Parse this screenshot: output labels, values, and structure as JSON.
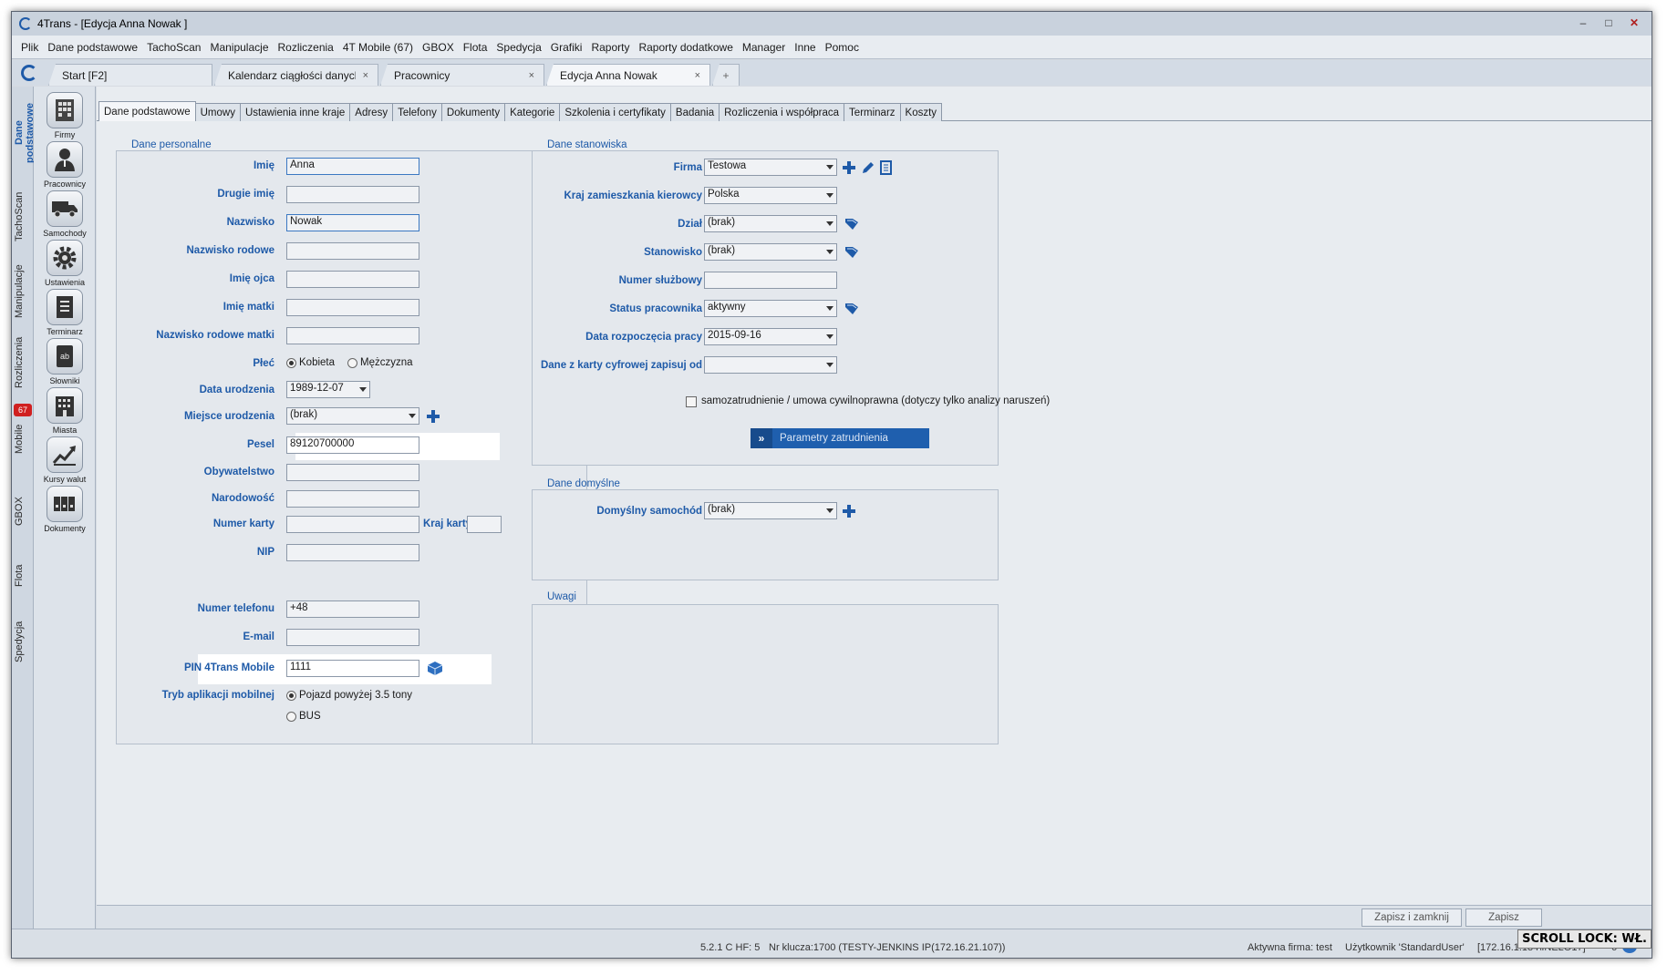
{
  "window": {
    "title": "4Trans - [Edycja   Anna Nowak   ]",
    "minimize": "–",
    "maximize": "□",
    "close": "✕"
  },
  "menu": [
    "Plik",
    "Dane podstawowe",
    "TachoScan",
    "Manipulacje",
    "Rozliczenia",
    "4T Mobile (67)",
    "GBOX",
    "Flota",
    "Spedycja",
    "Grafiki",
    "Raporty",
    "Raporty dodatkowe",
    "Manager",
    "Inne",
    "Pomoc"
  ],
  "doctabs": [
    {
      "label": "Start [F2]",
      "close": ""
    },
    {
      "label": "Kalendarz ciągłości danych",
      "close": "×"
    },
    {
      "label": "Pracownicy",
      "close": "×"
    },
    {
      "label": "Edycja Anna Nowak",
      "close": "×"
    }
  ],
  "doctab_add": "+",
  "vtabs": [
    "Dane podstawowe",
    "TachoScan",
    "Manipulacje",
    "Rozliczenia",
    "Mobile",
    "GBOX",
    "Flota",
    "Spedycja"
  ],
  "mobile_badge": "67",
  "navicons": [
    "Firmy",
    "Pracownicy",
    "Samochody",
    "Ustawienia",
    "Terminarz",
    "Słowniki",
    "Miasta",
    "Kursy walut",
    "Dokumenty"
  ],
  "subtabs": [
    "Dane podstawowe",
    "Umowy",
    "Ustawienia inne kraje",
    "Adresy",
    "Telefony",
    "Dokumenty",
    "Kategorie",
    "Szkolenia i certyfikaty",
    "Badania",
    "Rozliczenia i współpraca",
    "Terminarz",
    "Koszty"
  ],
  "personal": {
    "section_title": "Dane personalne",
    "imie_label": "Imię",
    "imie": "Anna",
    "drugie_label": "Drugie imię",
    "drugie": "",
    "nazwisko_label": "Nazwisko",
    "nazwisko": "Nowak",
    "rodowe_label": "Nazwisko rodowe",
    "rodowe": "",
    "ojca_label": "Imię ojca",
    "ojca": "",
    "matki_label": "Imię matki",
    "matki": "",
    "rodowe_matki_label": "Nazwisko rodowe matki",
    "rodowe_matki": "",
    "plec_label": "Płeć",
    "kobieta": "Kobieta",
    "mezczyzna": "Mężczyzna",
    "data_ur_label": "Data urodzenia",
    "data_ur": "1989-12-07",
    "miejsce_label": "Miejsce urodzenia",
    "miejsce": "(brak)",
    "pesel_label": "Pesel",
    "pesel": "89120700000",
    "obyw_label": "Obywatelstwo",
    "obyw": "",
    "narod_label": "Narodowość",
    "narod": "",
    "karta_label": "Numer karty",
    "karta": "",
    "kraj_karty_label": "Kraj karty",
    "kraj_karty": "",
    "nip_label": "NIP",
    "nip": "",
    "tel_label": "Numer telefonu",
    "tel": "+48",
    "email_label": "E-mail",
    "email": "",
    "pin_label": "PIN 4Trans Mobile",
    "pin": "1111",
    "tryb_label": "Tryb aplikacji mobilnej",
    "tryb1": "Pojazd powyżej 3.5 tony",
    "tryb2": "BUS"
  },
  "job": {
    "section_title": "Dane stanowiska",
    "firma_label": "Firma",
    "firma": "Testowa",
    "kraj_label": "Kraj zamieszkania kierowcy",
    "kraj": "Polska",
    "dzial_label": "Dział",
    "dzial": "(brak)",
    "stan_label": "Stanowisko",
    "stan": "(brak)",
    "numer_label": "Numer służbowy",
    "numer": "",
    "status_label": "Status pracownika",
    "status": "aktywny",
    "data_label": "Data rozpoczęcia pracy",
    "data": "2015-09-16",
    "karta_label": "Dane z karty cyfrowej zapisuj od",
    "karta": "",
    "samozat": "samozatrudnienie / umowa cywilnoprawna (dotyczy tylko analizy naruszeń)",
    "param_btn": "Parametry zatrudnienia"
  },
  "defaults": {
    "section_title": "Dane domyślne",
    "sam_label": "Domyślny samochód",
    "sam": "(brak)"
  },
  "notes": {
    "section_title": "Uwagi"
  },
  "buttons": {
    "zapisz_zamknij": "Zapisz i zamknij",
    "zapisz": "Zapisz"
  },
  "status": {
    "version": "5.2.1 C HF: 5",
    "klucz": "Nr klucza:1700 (TESTY-JENKINS IP(172.16.21.107))",
    "firma": "Aktywna firma: test",
    "user": "Użytkownik 'StandardUser'",
    "ip": "[172.16.1.134\\INELO17]",
    "count": "6"
  },
  "scroll_lock": "SCROLL LOCK: WŁ.",
  "colors": {
    "accent": "#1e5aa8",
    "highlight": "#ffffff"
  }
}
